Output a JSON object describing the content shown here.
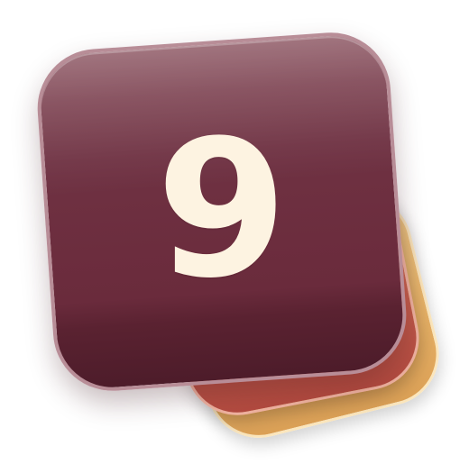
{
  "icon": {
    "number_label": "9",
    "colors": {
      "front_card": "#6c2d3e",
      "middle_card": "#c8614f",
      "back_card": "#e9b56a",
      "digit": "#fdf3e1"
    }
  }
}
